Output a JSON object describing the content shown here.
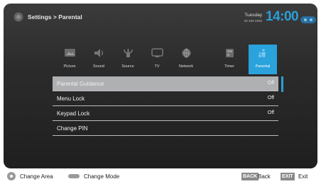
{
  "header": {
    "breadcrumb": "Settings > Parental",
    "day": "Tuesday",
    "date": "xx xxx xxxx",
    "time": "14:00"
  },
  "tabs": [
    {
      "label": "Picture",
      "icon": "picture-icon"
    },
    {
      "label": "Sound",
      "icon": "sound-icon"
    },
    {
      "label": "Source",
      "icon": "source-icon"
    },
    {
      "label": "TV",
      "icon": "tv-icon"
    },
    {
      "label": "Network",
      "icon": "network-icon"
    },
    {
      "label": "Timer",
      "icon": "timer-icon"
    },
    {
      "label": "Parental",
      "icon": "parental-icon",
      "active": true
    }
  ],
  "menu": [
    {
      "label": "Parental Guidance",
      "value": "Off",
      "selected": true
    },
    {
      "label": "Menu Lock",
      "value": "Off"
    },
    {
      "label": "Keypad Lock",
      "value": "Off"
    },
    {
      "label": "Change PIN",
      "value": ""
    }
  ],
  "footer": {
    "change_area": "Change Area",
    "change_mode": "Change Mode",
    "back_key": "BACK",
    "back_label": "Back",
    "exit_key": "EXIT",
    "exit_label": "Exit"
  },
  "colors": {
    "accent": "#2aa2dc",
    "clock": "#2a9fd8",
    "selected_row": "#aeb0b2"
  }
}
